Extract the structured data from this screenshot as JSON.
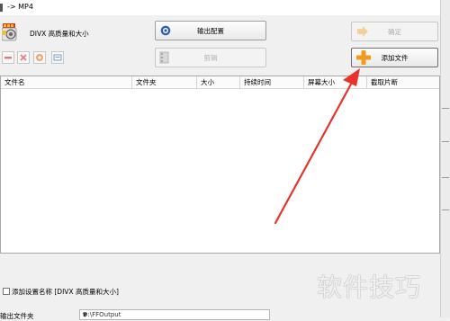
{
  "window": {
    "title": "-> MP4"
  },
  "format": {
    "label": "DIVX 高质量和大小",
    "icon": "mp4-format-icon"
  },
  "buttons": {
    "output_config": "输出配置",
    "ok": "确定",
    "edit": "剪辑",
    "add_file": "添加文件"
  },
  "toolbar": [
    {
      "name": "remove-icon"
    },
    {
      "name": "clear-icon"
    },
    {
      "name": "play-icon"
    },
    {
      "name": "info-icon"
    }
  ],
  "table": {
    "columns": [
      "文件名",
      "文件夹",
      "大小",
      "持续时间",
      "屏幕大小",
      "截取片断"
    ]
  },
  "footer": {
    "save_label": "添加设置名称 [DIVX 高质量和大小]",
    "output_dir_label": "输出文件夹",
    "output_dir_value": "D:\\FFOutput"
  },
  "watermark": "软件技巧",
  "colors": {
    "accent_orange": "#f39a1e",
    "arrow_red": "#e8332a"
  }
}
